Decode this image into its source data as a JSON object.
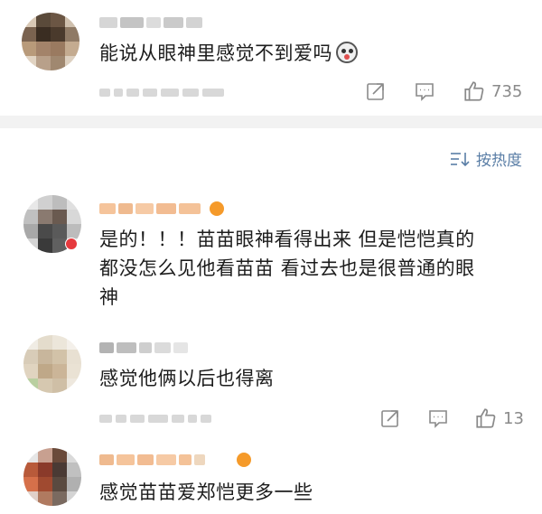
{
  "post": {
    "text": "能说从眼神里感觉不到爱吗",
    "emoji_icon": "shocked-face-icon",
    "actions": {
      "share_icon": "share-icon",
      "comment_icon": "comment-icon",
      "like_icon": "thumbs-up-icon",
      "like_count": "735"
    }
  },
  "sort": {
    "icon": "sort-icon",
    "label": "按热度"
  },
  "comments": [
    {
      "line1": "是的！！！苗苗眼神看得出来  但是恺恺真的",
      "line2": "都没怎么见他看苗苗  看过去也是很普通的眼",
      "line3": "神"
    },
    {
      "line1": "感觉他俩以后也得离",
      "like_count": "13"
    },
    {
      "line1": "感觉苗苗爱郑恺更多一些"
    }
  ],
  "colors": {
    "link_blue": "#5a7ea6",
    "icon_gray": "#8a8a8a",
    "band_gray": "#f2f2f2",
    "badge_orange": "#f59a2a"
  }
}
